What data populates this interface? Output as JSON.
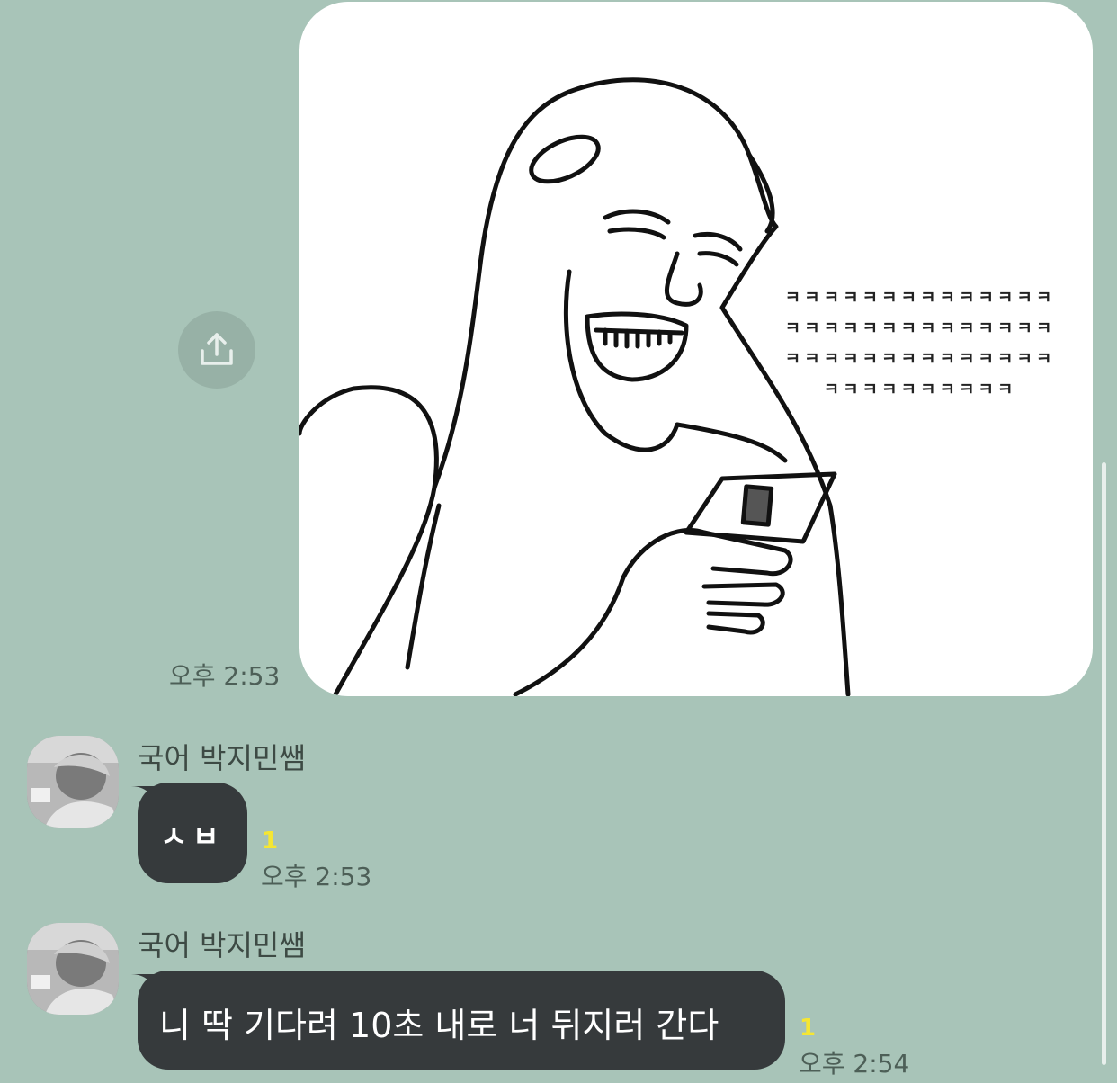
{
  "messages": [
    {
      "type": "image",
      "image_text_lines": [
        "ㅋㅋㅋㅋㅋㅋㅋㅋㅋㅋㅋㅋㅋㅋ",
        "ㅋㅋㅋㅋㅋㅋㅋㅋㅋㅋㅋㅋㅋㅋ",
        "ㅋㅋㅋㅋㅋㅋㅋㅋㅋㅋㅋㅋㅋㅋ",
        "ㅋㅋㅋㅋㅋㅋㅋㅋㅋㅋ"
      ],
      "time": "오후 2:53",
      "share_icon": "share-icon"
    },
    {
      "type": "text",
      "sender": "국어 박지민쌤",
      "text": "ㅅㅂ",
      "unread": "1",
      "time": "오후 2:53"
    },
    {
      "type": "text",
      "sender": "국어 박지민쌤",
      "text": "니 딱 기다려 10초 내로 너 뒤지러 간다",
      "unread": "1",
      "time": "오후 2:54"
    }
  ],
  "colors": {
    "background": "#a8c4b8",
    "bubble": "#363a3c",
    "unread": "#f5e633"
  }
}
